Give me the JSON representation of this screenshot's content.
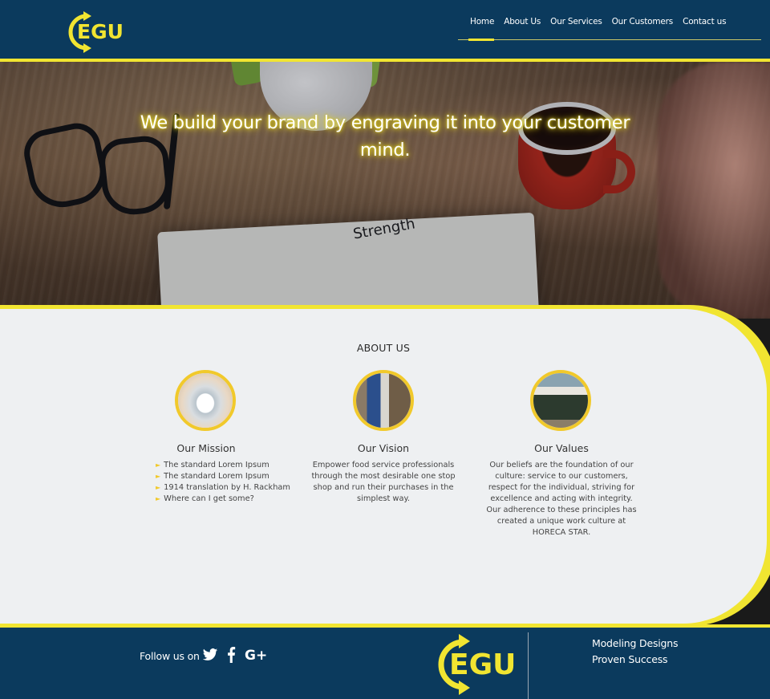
{
  "header": {
    "logo_text": "EGU",
    "nav": [
      {
        "label": "Home"
      },
      {
        "label": "About Us"
      },
      {
        "label": "Our Services"
      },
      {
        "label": "Our Customers"
      },
      {
        "label": "Contact us"
      }
    ],
    "active_nav": "Home"
  },
  "hero": {
    "headline": "We build your brand by engraving it into your customer mind.",
    "notebook_doodle": "Strength"
  },
  "about": {
    "title": "ABOUT US",
    "mission": {
      "title": "Our Mission",
      "items": [
        "The standard Lorem Ipsum",
        "The standard Lorem Ipsum",
        "1914 translation by H. Rackham",
        "Where can I get some?"
      ]
    },
    "vision": {
      "title": "Our Vision",
      "text": "Empower food service professionals through the most desirable one stop shop and run their purchases in the simplest way."
    },
    "values": {
      "title": "Our Values",
      "text": "Our beliefs are the foundation of our culture: service to our customers, respect for the individual, striving for excellence and acting with integrity. Our adherence to these principles has created a unique work culture at HORECA STAR."
    }
  },
  "footer": {
    "follow_label": "Follow us on",
    "social": [
      "twitter-icon",
      "facebook-icon",
      "google-plus-icon"
    ],
    "logo_text": "EGU",
    "tagline_1": "Modeling Designs",
    "tagline_2": "Proven Success"
  },
  "colors": {
    "navy": "#0b3a5d",
    "yellow": "#f1e531",
    "about_bg": "#eef0f2",
    "circle_border": "#f1c92b"
  }
}
